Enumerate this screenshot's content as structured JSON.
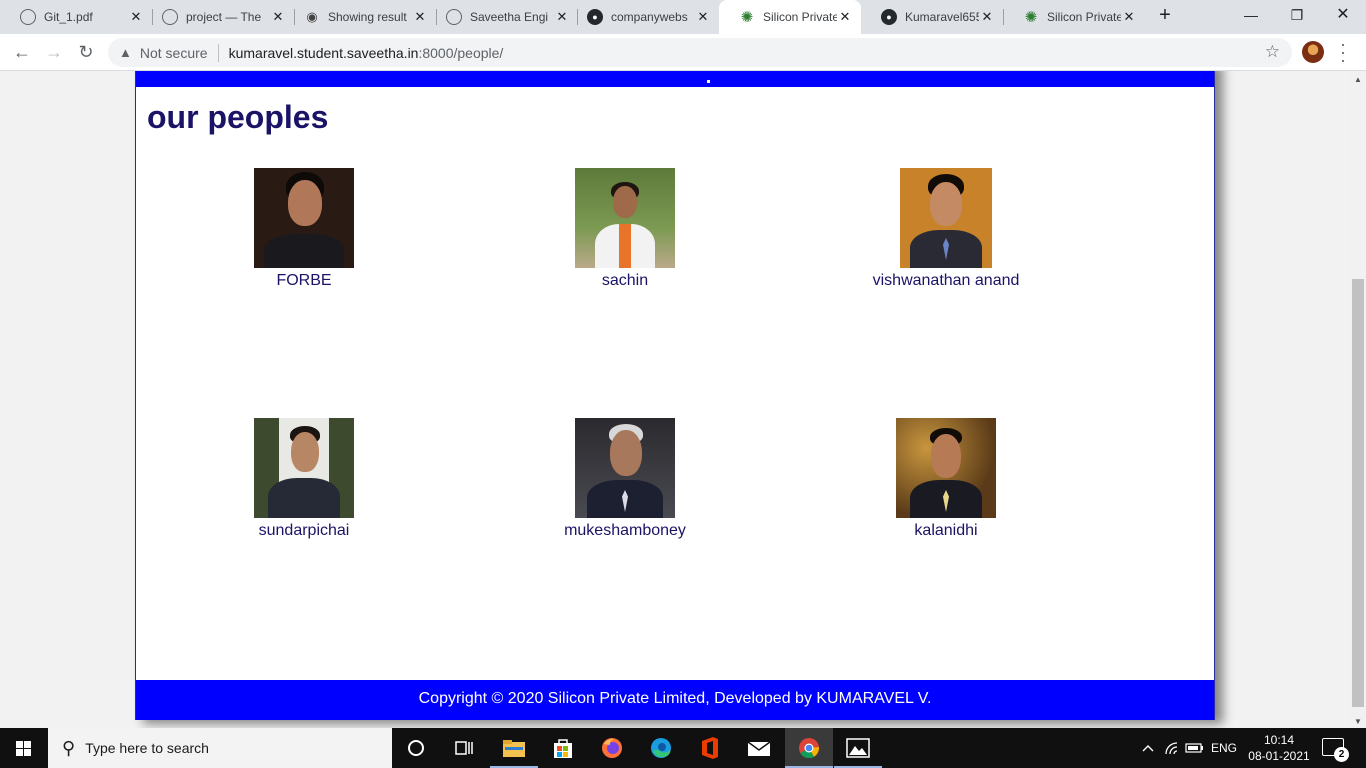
{
  "browser": {
    "tabs": [
      {
        "title": "Git_1.pdf",
        "icon": "globe-icon"
      },
      {
        "title": "project — The",
        "icon": "globe-icon"
      },
      {
        "title": "Showing result",
        "icon": "ubuntu-icon"
      },
      {
        "title": "Saveetha Engi",
        "icon": "globe-icon"
      },
      {
        "title": "companywebs",
        "icon": "github-icon"
      },
      {
        "title": "Silicon Private",
        "icon": "virus-icon",
        "active": true
      },
      {
        "title": "Kumaravel655",
        "icon": "github-icon"
      },
      {
        "title": "Silicon Private",
        "icon": "virus-icon"
      }
    ],
    "security_label": "Not secure",
    "url_host": "kumaravel.student.saveetha.in",
    "url_path": ":8000/people/"
  },
  "page": {
    "heading": "our peoples",
    "people": [
      {
        "name": "FORBE"
      },
      {
        "name": "sachin"
      },
      {
        "name": "vishwanathan anand"
      },
      {
        "name": "sundarpichai"
      },
      {
        "name": "mukeshamboney"
      },
      {
        "name": "kalanidhi"
      }
    ],
    "footer": "Copyright © 2020 Silicon Private Limited, Developed by KUMARAVEL V."
  },
  "taskbar": {
    "search_placeholder": "Type here to search",
    "language": "ENG",
    "time": "10:14",
    "date": "08-01-2021",
    "notification_count": "2"
  },
  "colors": {
    "site_blue": "#0000ff",
    "heading_color": "#1a1366"
  }
}
